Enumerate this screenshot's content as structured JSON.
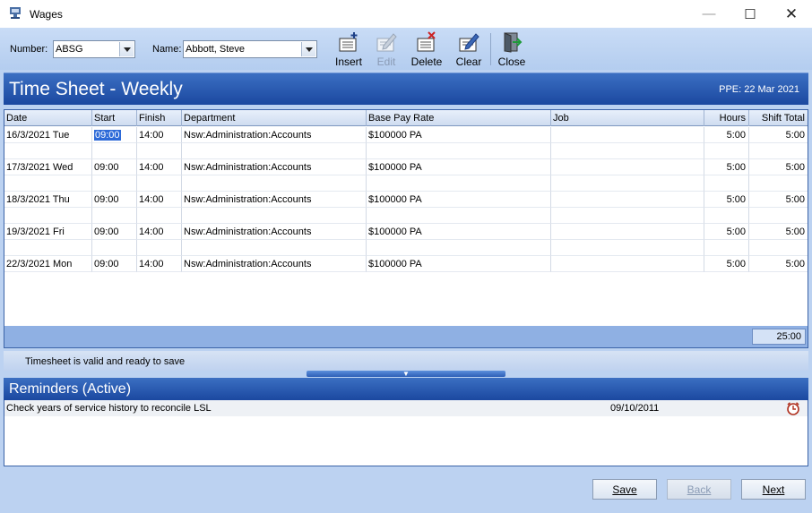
{
  "window": {
    "title": "Wages",
    "min_glyph": "—",
    "max_glyph": "☐",
    "close_glyph": "✕"
  },
  "toolbar": {
    "number_label": "Number:",
    "number_value": "ABSG",
    "name_label": "Name:",
    "name_value": "Abbott, Steve",
    "tools": {
      "insert": "Insert",
      "edit": "Edit",
      "delete": "Delete",
      "clear": "Clear",
      "close": "Close"
    }
  },
  "sheet": {
    "title": "Time Sheet - Weekly",
    "ppe": "PPE: 22 Mar 2021"
  },
  "grid": {
    "columns": [
      "Date",
      "Start",
      "Finish",
      "Department",
      "Base Pay Rate",
      "Job",
      "Hours",
      "Shift Total"
    ],
    "rows": [
      {
        "date": "16/3/2021 Tue",
        "start": "09:00",
        "finish": "14:00",
        "department": "Nsw:Administration:Accounts",
        "rate": "$100000 PA",
        "job": "",
        "hours": "5:00",
        "total": "5:00"
      },
      {
        "date": "17/3/2021 Wed",
        "start": "09:00",
        "finish": "14:00",
        "department": "Nsw:Administration:Accounts",
        "rate": "$100000 PA",
        "job": "",
        "hours": "5:00",
        "total": "5:00"
      },
      {
        "date": "18/3/2021 Thu",
        "start": "09:00",
        "finish": "14:00",
        "department": "Nsw:Administration:Accounts",
        "rate": "$100000 PA",
        "job": "",
        "hours": "5:00",
        "total": "5:00"
      },
      {
        "date": "19/3/2021 Fri",
        "start": "09:00",
        "finish": "14:00",
        "department": "Nsw:Administration:Accounts",
        "rate": "$100000 PA",
        "job": "",
        "hours": "5:00",
        "total": "5:00"
      },
      {
        "date": "22/3/2021 Mon",
        "start": "09:00",
        "finish": "14:00",
        "department": "Nsw:Administration:Accounts",
        "rate": "$100000 PA",
        "job": "",
        "hours": "5:00",
        "total": "5:00"
      }
    ],
    "grand_total": "25:00"
  },
  "status": {
    "message": "Timesheet is valid and ready to save"
  },
  "reminders": {
    "title": "Reminders (Active)",
    "items": [
      {
        "text": "Check years of service history to reconcile LSL",
        "date": "09/10/2011",
        "icon": "alarm-clock-icon"
      }
    ]
  },
  "footer": {
    "save": "Save",
    "back": "Back",
    "next": "Next"
  },
  "colors": {
    "band_dark": "#1b48a0",
    "band_light": "#3b6fc2",
    "background": "#bcd2f1",
    "selection": "#2d6ad8"
  }
}
